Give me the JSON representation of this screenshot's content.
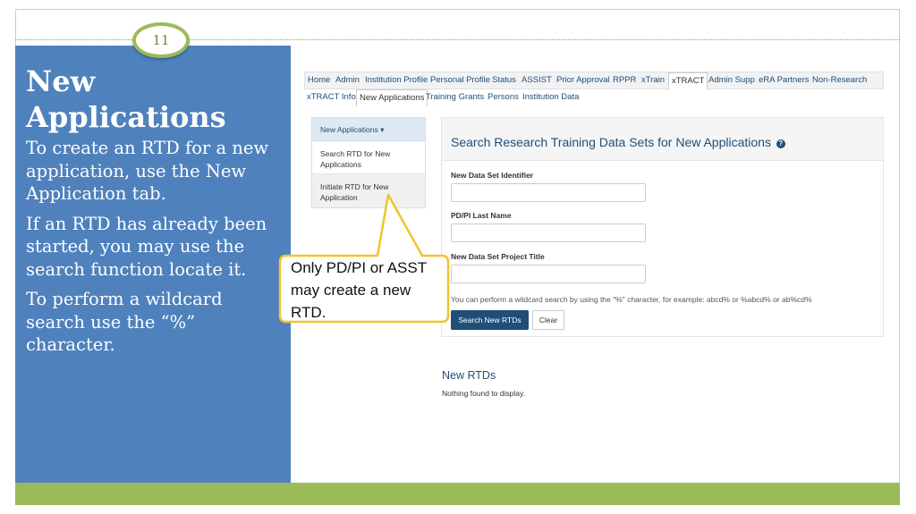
{
  "slide": {
    "number": "11",
    "title": "New Applications",
    "paragraphs": [
      "To create an RTD for a new application, use the New Application tab.",
      "If an RTD has already been started, you may use the search function locate it.",
      "To perform a wildcard search use the “%” character."
    ],
    "callout": "Only PD/PI or ASST may create a new RTD.",
    "colors": {
      "sidebar": "#4f81bd",
      "accent": "#9bbb59",
      "callout_border": "#f2c230"
    }
  },
  "nav": {
    "primary": [
      "Home",
      "Admin",
      "Institution Profile",
      "Personal Profile",
      "Status",
      "ASSIST",
      "Prior Approval",
      "RPPR",
      "xTrain",
      "xTRACT",
      "Admin Supp",
      "eRA Partners",
      "Non-Research"
    ],
    "primary_active": "xTRACT",
    "secondary": [
      "xTRACT Info",
      "New Applications",
      "Training Grants",
      "Persons",
      "Institution Data"
    ],
    "secondary_active": "New Applications"
  },
  "left_menu": {
    "header": "New Applications",
    "items": [
      "Search RTD for New Applications",
      "Initiate RTD for New Application"
    ]
  },
  "search_panel": {
    "title": "Search Research Training Data Sets for New Applications",
    "help_icon": "question-circle-icon",
    "fields": [
      {
        "label": "New Data Set Identifier",
        "value": ""
      },
      {
        "label": "PD/PI Last Name",
        "value": ""
      },
      {
        "label": "New Data Set Project Title",
        "value": ""
      }
    ],
    "hint": "You can perform a wildcard search by using the \"%\" character, for example: abcd% or %abcd% or ab%cd%",
    "search_button": "Search New RTDs",
    "clear_button": "Clear"
  },
  "results": {
    "title": "New RTDs",
    "empty_message": "Nothing found to display."
  }
}
